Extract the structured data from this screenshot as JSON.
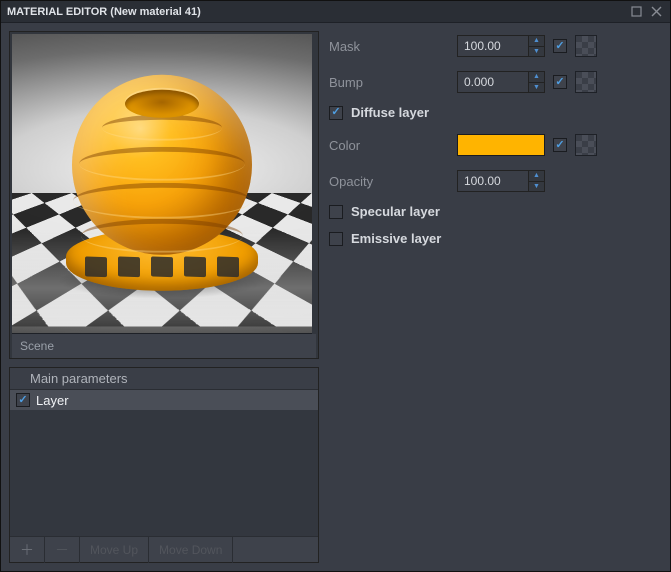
{
  "window": {
    "title": "MATERIAL EDITOR (New material 41)"
  },
  "preview": {
    "footer_label": "Scene"
  },
  "params": {
    "header": "Main parameters",
    "layer_item": {
      "label": "Layer",
      "checked": true
    },
    "buttons": {
      "add": "＋",
      "remove": "－",
      "move_up": "Move Up",
      "move_down": "Move Down"
    }
  },
  "props": {
    "mask": {
      "label": "Mask",
      "value": "100.00",
      "link_checked": true
    },
    "bump": {
      "label": "Bump",
      "value": "0.000",
      "link_checked": true
    },
    "diffuse": {
      "label": "Diffuse layer",
      "checked": true
    },
    "color": {
      "label": "Color",
      "hex": "#ffb400",
      "link_checked": true
    },
    "opacity": {
      "label": "Opacity",
      "value": "100.00"
    },
    "specular": {
      "label": "Specular layer",
      "checked": false
    },
    "emissive": {
      "label": "Emissive layer",
      "checked": false
    }
  }
}
